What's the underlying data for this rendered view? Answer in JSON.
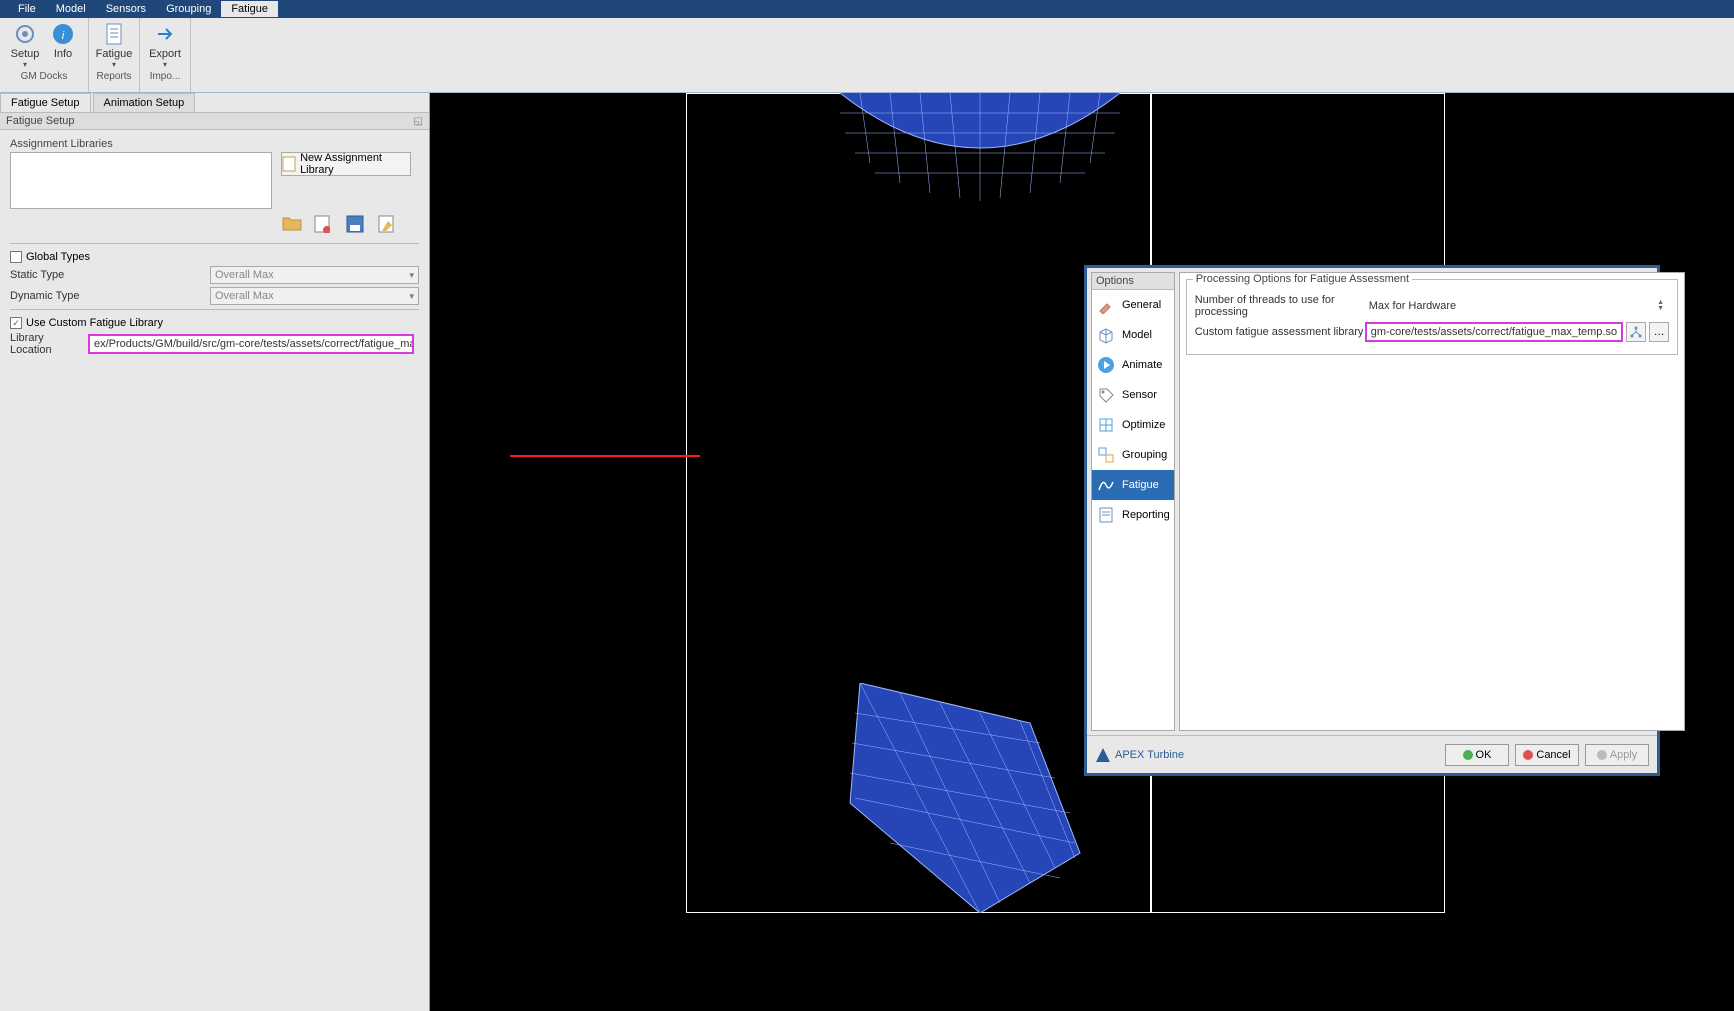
{
  "menu": {
    "items": [
      "File",
      "Model",
      "Sensors",
      "Grouping",
      "Fatigue"
    ],
    "active": 4
  },
  "ribbon": {
    "groups": [
      {
        "label": "GM Docks",
        "buttons": [
          {
            "label": "Setup",
            "icon": "gear"
          },
          {
            "label": "Info",
            "icon": "info"
          }
        ]
      },
      {
        "label": "Reports",
        "buttons": [
          {
            "label": "Fatigue",
            "icon": "doc"
          }
        ]
      },
      {
        "label": "Impo...",
        "buttons": [
          {
            "label": "Export",
            "icon": "arrow-right"
          }
        ]
      }
    ]
  },
  "side": {
    "tabs": [
      "Fatigue Setup",
      "Animation Setup"
    ],
    "active_tab": 0,
    "panel_title": "Fatigue Setup",
    "assignment_label": "Assignment Libraries",
    "new_btn": "New Assignment Library",
    "global_types": "Global Types",
    "static_label": "Static Type",
    "static_value": "Overall Max",
    "dynamic_label": "Dynamic Type",
    "dynamic_value": "Overall Max",
    "use_custom": "Use Custom Fatigue Library",
    "use_custom_checked": true,
    "loc_label": "Library Location",
    "loc_value": "ex/Products/GM/build/src/gm-core/tests/assets/correct/fatigue_max_temp.so"
  },
  "dialog": {
    "list_header": "Options",
    "items": [
      "General",
      "Model",
      "Animate",
      "Sensor",
      "Optimize",
      "Grouping",
      "Fatigue",
      "Reporting"
    ],
    "selected": 6,
    "fieldset_title": "Processing Options for Fatigue Assessment",
    "threads_label": "Number of threads to use for processing",
    "threads_value": "Max for Hardware",
    "lib_label": "Custom fatigue assessment library",
    "lib_value": "gm-core/tests/assets/correct/fatigue_max_temp.so",
    "brand": "APEX Turbine",
    "ok": "OK",
    "cancel": "Cancel",
    "apply": "Apply"
  }
}
